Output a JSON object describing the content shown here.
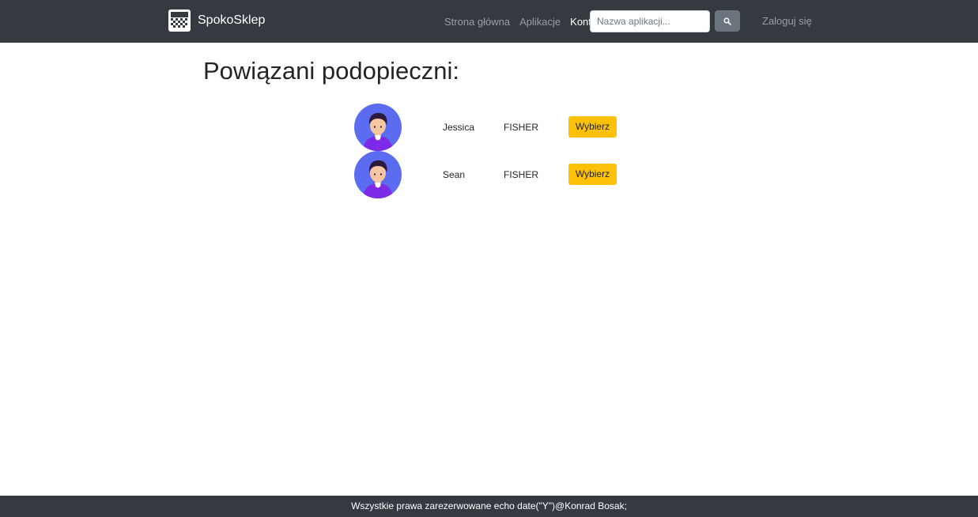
{
  "navbar": {
    "brand_name": "SpokoSklep",
    "brand_logo_icon": "store-icon",
    "links": [
      {
        "label": "Strona główna",
        "active": false
      },
      {
        "label": "Aplikacje",
        "active": false
      },
      {
        "label": "Konto",
        "active": true
      }
    ],
    "search": {
      "value": "",
      "placeholder": "Nazwa aplikacji...",
      "button_icon": "search-icon"
    },
    "login_label": "Zaloguj się"
  },
  "main": {
    "title": "Powiązani podopieczni:",
    "wards": [
      {
        "avatar_icon": "user-avatar-icon",
        "first_name": "Jessica",
        "last_name": "FISHER",
        "select_label": "Wybierz"
      },
      {
        "avatar_icon": "user-avatar-icon",
        "first_name": "Sean",
        "last_name": "FISHER",
        "select_label": "Wybierz"
      }
    ]
  },
  "footer": {
    "text": "Wszystkie prawa zarezerwowane echo date(\"Y\")@Konrad Bosak;"
  },
  "colors": {
    "navbar_bg": "#343a40",
    "footer_bg": "#343a40",
    "accent_button": "#ffc107",
    "search_button": "#6c757d",
    "avatar_bg": "#5b6cf0"
  }
}
